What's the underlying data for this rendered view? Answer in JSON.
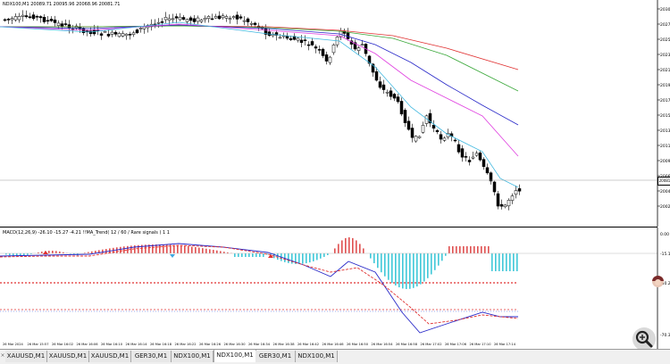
{
  "window": {
    "symbol_label": "NDX100,M1  20089.71 20095.96 20068.96 20081.71",
    "indicator_label": "MACD(12,26,9) -26.10 -15.27 -4.21  !!MA_Trend( 12 / 60 / Rare signals ) 1 1",
    "current_price": "20081"
  },
  "price_axis": {
    "labels": [
      "20300",
      "20279",
      "20258",
      "20237",
      "20216",
      "20195",
      "20174",
      "20153",
      "20132",
      "20111",
      "20090",
      "20069",
      "20048",
      "20027"
    ]
  },
  "indicator_axis": {
    "labels": [
      "0.00",
      "-15.10",
      "-50.22",
      "-70.30"
    ]
  },
  "time_axis": {
    "labels": [
      "26 Mar 2024",
      "26 Mar 15:57",
      "26 Mar 16:02",
      "26 Mar 16:06",
      "26 Mar 16:10",
      "26 Mar 16:14",
      "26 Mar 16:18",
      "26 Mar 16:22",
      "26 Mar 16:26",
      "26 Mar 16:30",
      "26 Mar 16:34",
      "26 Mar 16:38",
      "26 Mar 16:42",
      "26 Mar 16:46",
      "26 Mar 16:50",
      "26 Mar 16:54",
      "26 Mar 16:58",
      "26 Mar 17:02",
      "26 Mar 17:06",
      "26 Mar 17:10",
      "26 Mar 17:14"
    ]
  },
  "tabs": [
    {
      "label": "XAUUSD,M1"
    },
    {
      "label": "XAUUSD,M1"
    },
    {
      "label": "XAUUSD,M1"
    },
    {
      "label": "GER30,M1"
    },
    {
      "label": "NDX100,M1"
    },
    {
      "label": "NDX100,M1",
      "active": true
    },
    {
      "label": "GER30,M1"
    },
    {
      "label": "NDX100,M1"
    }
  ],
  "colors": {
    "bull_candle": "#ffffff",
    "bear_candle": "#000000",
    "ma_red": "#e03030",
    "ma_green": "#3aa83a",
    "ma_blue": "#2828c8",
    "ma_magenta": "#e040e0",
    "ma_cyan": "#40b8e0",
    "hist_positive": "#e05050",
    "hist_negative": "#40c8d8",
    "level_line": "#e03030",
    "level_line_blue": "#4060e0"
  },
  "icons": {
    "zoom": "zoom-icon",
    "avatar": "avatar-icon",
    "tab_scroll": "tab-close-icon"
  }
}
